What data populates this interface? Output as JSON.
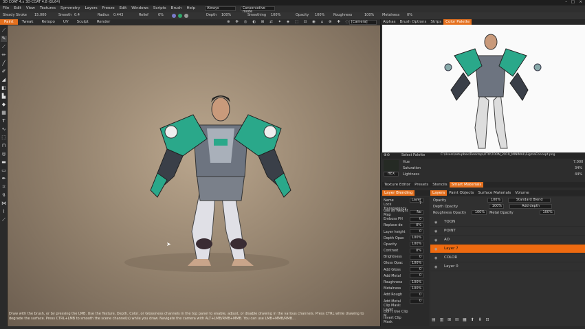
{
  "titlebar": {
    "title": "3D COAT 4.x  3D-COAT 4.8  (GL64)"
  },
  "menubar": {
    "items": [
      "File",
      "Edit",
      "View",
      "Textures",
      "Symmetry",
      "Layers",
      "Freeze",
      "Edit",
      "Windows",
      "Scripts",
      "Brush",
      "Help"
    ],
    "dropdown_value": "Always",
    "mode_value": "Conservative mode"
  },
  "params": {
    "steady_label": "Steady Stroke",
    "steady_val": "15.000",
    "smooth_label": "Smooth",
    "smooth_val": "0.4",
    "radius_label": "Radius",
    "radius_val": "0.443",
    "relief_label": "Relief",
    "relief_val": "0%",
    "depth_label": "Depth",
    "depth_val": "100%",
    "smoothing_label": "Smoothing",
    "smoothing_val": "100%",
    "opacity_label": "Opacity",
    "opacity_val": "100%",
    "roughness_label": "Roughness",
    "roughness_val": "100%",
    "metalness_label": "Metalness",
    "metalness_val": "0%"
  },
  "rooms": [
    "Paint",
    "Tweak",
    "Retopo",
    "UV",
    "Sculpt",
    "Render"
  ],
  "active_room": "Paint",
  "view_dropdown": "[Camera]",
  "right_top_tabs": [
    "Alphas",
    "Brush Options",
    "Strips",
    "Color Palette"
  ],
  "right_top_active": "Color Palette",
  "refbar": {
    "select_label": "Select Palette",
    "path": "C:\\Users\\setupbox\\Desktop\\UTO\\TOON_2019_MINIMAL\\SigmaConcept.png"
  },
  "hsl": {
    "hue_label": "Hue",
    "hue_val": "7.000",
    "sat_label": "Saturation",
    "sat_val": "34%",
    "light_label": "Lightness",
    "light_val": "44%",
    "hex": "HEX"
  },
  "mid_tabs": [
    "Texture Editor",
    "Presets",
    "Stencils",
    "Smart Materials"
  ],
  "mid_active": "Smart Materials",
  "layers_left_tabs": [
    "Layer Blending"
  ],
  "layers_right_tabs": [
    "Layers",
    "Paint Objects",
    "Surface Materials",
    "Volume"
  ],
  "layers_right_active": "Layers",
  "layer_props": {
    "name_label": "Name",
    "name_val": "Layer 7",
    "lock_transp": "Lock Transparency",
    "use_weight_map": "Use as Weight Map",
    "use_weight_val": "No",
    "emboss": "Emboss PH",
    "emboss_val": "0",
    "replace_de": "Replace de",
    "replace_val": "0%",
    "layer_height": "Layer height",
    "layer_height_val": "0",
    "depth_opacity": "Depth Opac",
    "depth_opacity_val": "100%",
    "opacity": "Opacity",
    "opacity_val": "100%",
    "contrast": "Contrast",
    "contrast_val": "0%",
    "brightness": "Brightness",
    "brightness_val": "0",
    "gloss_opacity": "Gloss Opac",
    "gloss_opacity_val": "100%",
    "add_gloss": "Add Gloss",
    "add_gloss_val": "0",
    "add_metal": "Add Metal",
    "add_metal_val": "0",
    "roughness": "Roughness",
    "roughness_val": "100%",
    "metalness": "Metalness",
    "metalness_val": "100%",
    "add_rough": "Add Rough",
    "add_rough_val": "0",
    "add_metal2": "Add Metal",
    "add_metal2_val": "0",
    "clip_mask": "Clip Mask: Layer",
    "dont_use": "Don't Use Clip M",
    "invert_clip": "Invert Clip Mask"
  },
  "layer_top": {
    "opacity_label": "Opacity",
    "opacity_val": "100%",
    "blend_val": "Standard Blend",
    "depth_label": "Depth Opacity",
    "depth_val": "100%",
    "add_depth": "Add depth",
    "rough_label": "Roughness Opacity",
    "rough_val": "100%",
    "metal_label": "Metal Opacity",
    "metal_val": "100%"
  },
  "layers": [
    "TOON",
    "POINT",
    "AO",
    "Layer 7",
    "COLOR",
    "Layer 0"
  ],
  "active_layer": "Layer 7",
  "hint": "Draw with the brush, or by pressing the LMB. Use the Texture, Depth, Color, or Glossiness channels in the top panel to enable, adjust, or disable drawing in the various channels. Press CTRL while drawing to degrade the surface. Press CTRL+LMB to smooth the scene channel(s) while you draw. Navigate the camera with ALT+LMB/RMB+MMB. You can use LMB+MMB/RMB...",
  "colors": {
    "accent": "#ee6a10",
    "teal": "#2aa88a",
    "armor": "#4a4a55"
  }
}
